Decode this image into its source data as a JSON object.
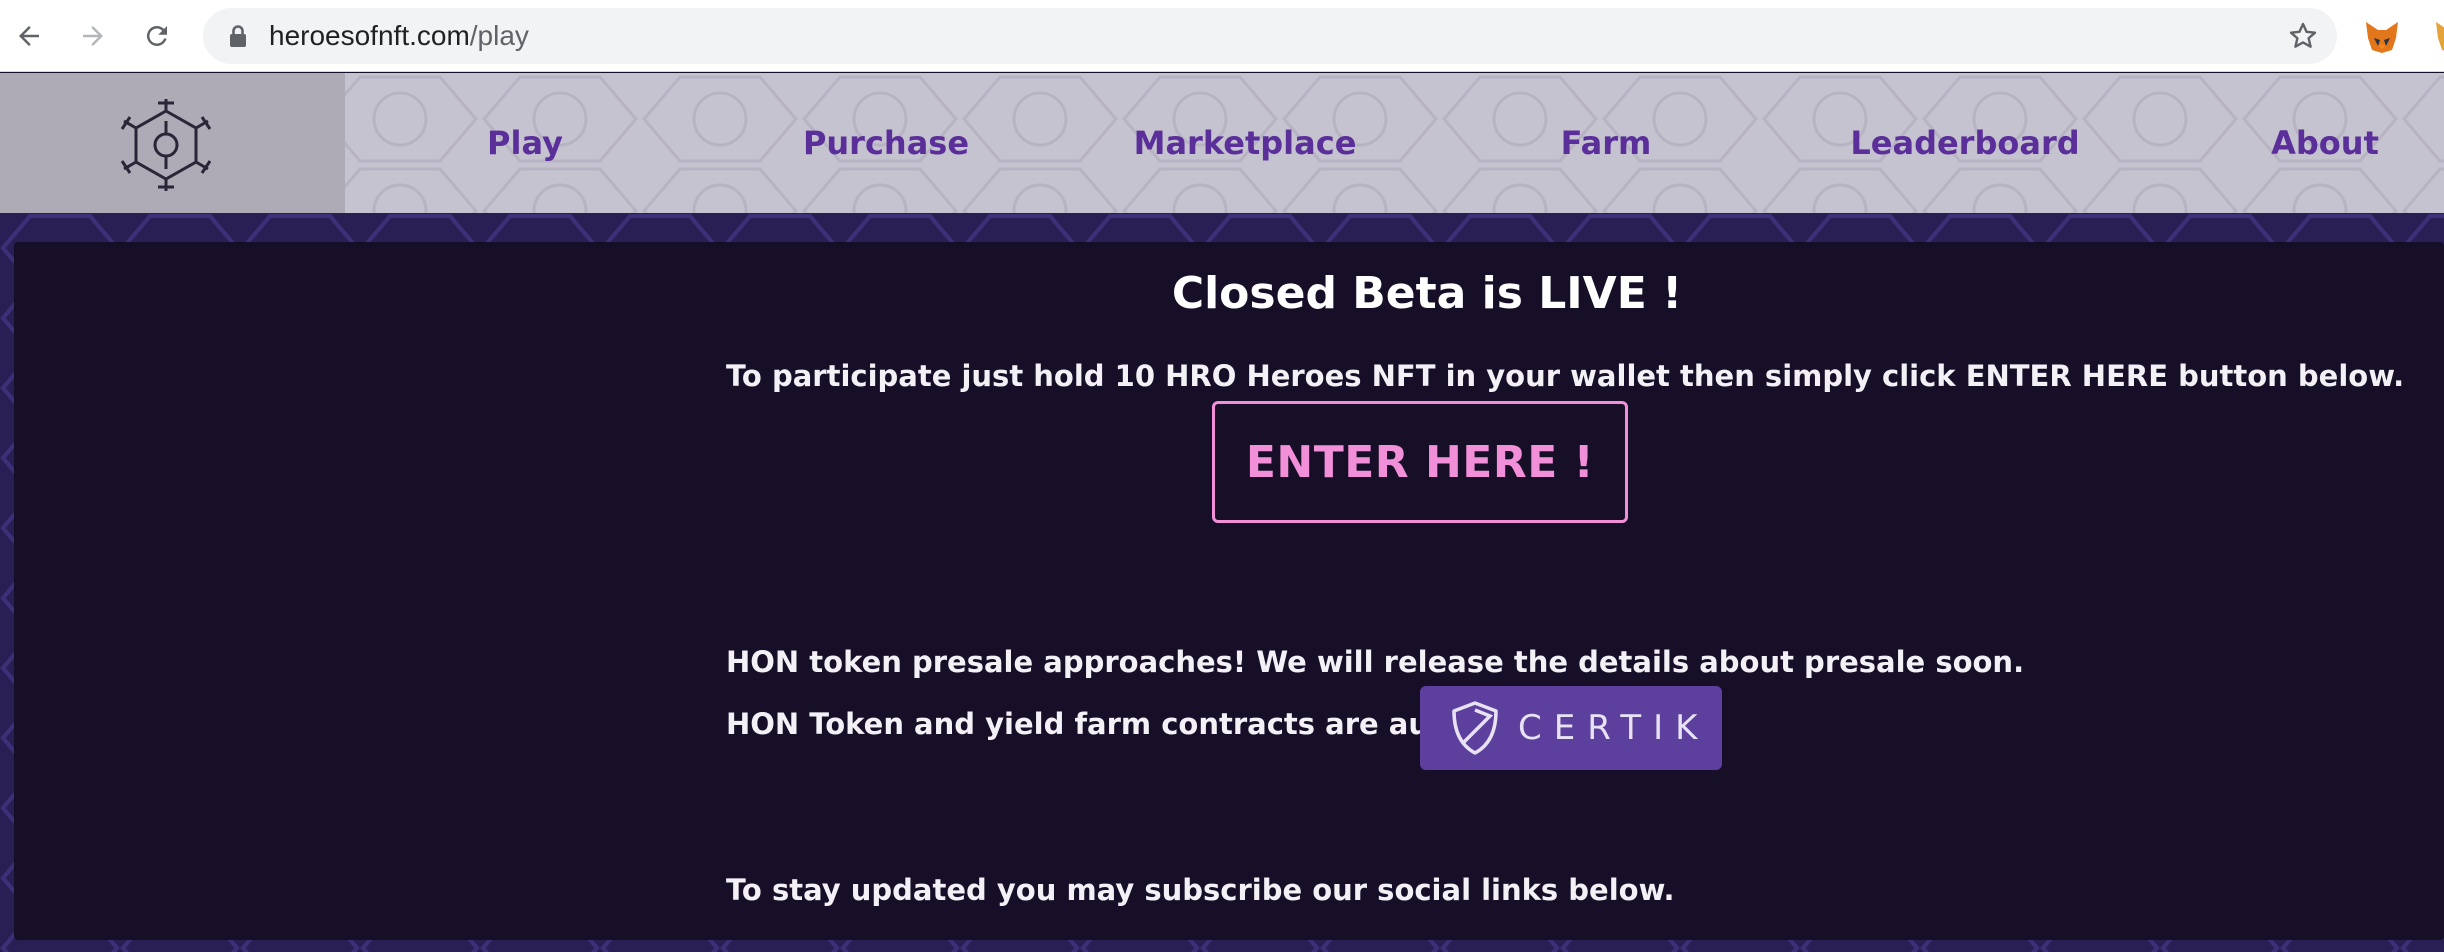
{
  "browser": {
    "url_domain": "heroesofnft.com",
    "url_path": "/play"
  },
  "site_nav": {
    "items": [
      {
        "label": "Play"
      },
      {
        "label": "Purchase"
      },
      {
        "label": "Marketplace"
      },
      {
        "label": "Farm"
      },
      {
        "label": "Leaderboard"
      },
      {
        "label": "About"
      }
    ]
  },
  "main": {
    "title": "Closed Beta is LIVE !",
    "instructions": "To participate just hold 10 HRO Heroes NFT in your wallet then simply click ENTER HERE button below.",
    "enter_label": "ENTER HERE !",
    "presale_text": "HON token presale approaches! We will release the details about presale soon.",
    "audit_text": "HON Token and yield farm contracts are audited by",
    "certik_label": "CERTIK",
    "subscribe_text": "To stay updated you may subscribe our social links below."
  },
  "colors": {
    "accent_pink": "#f28fd9",
    "nav_purple": "#5b2f9a",
    "panel_bg": "#170f28",
    "certik_bg": "#5d3f9e"
  }
}
